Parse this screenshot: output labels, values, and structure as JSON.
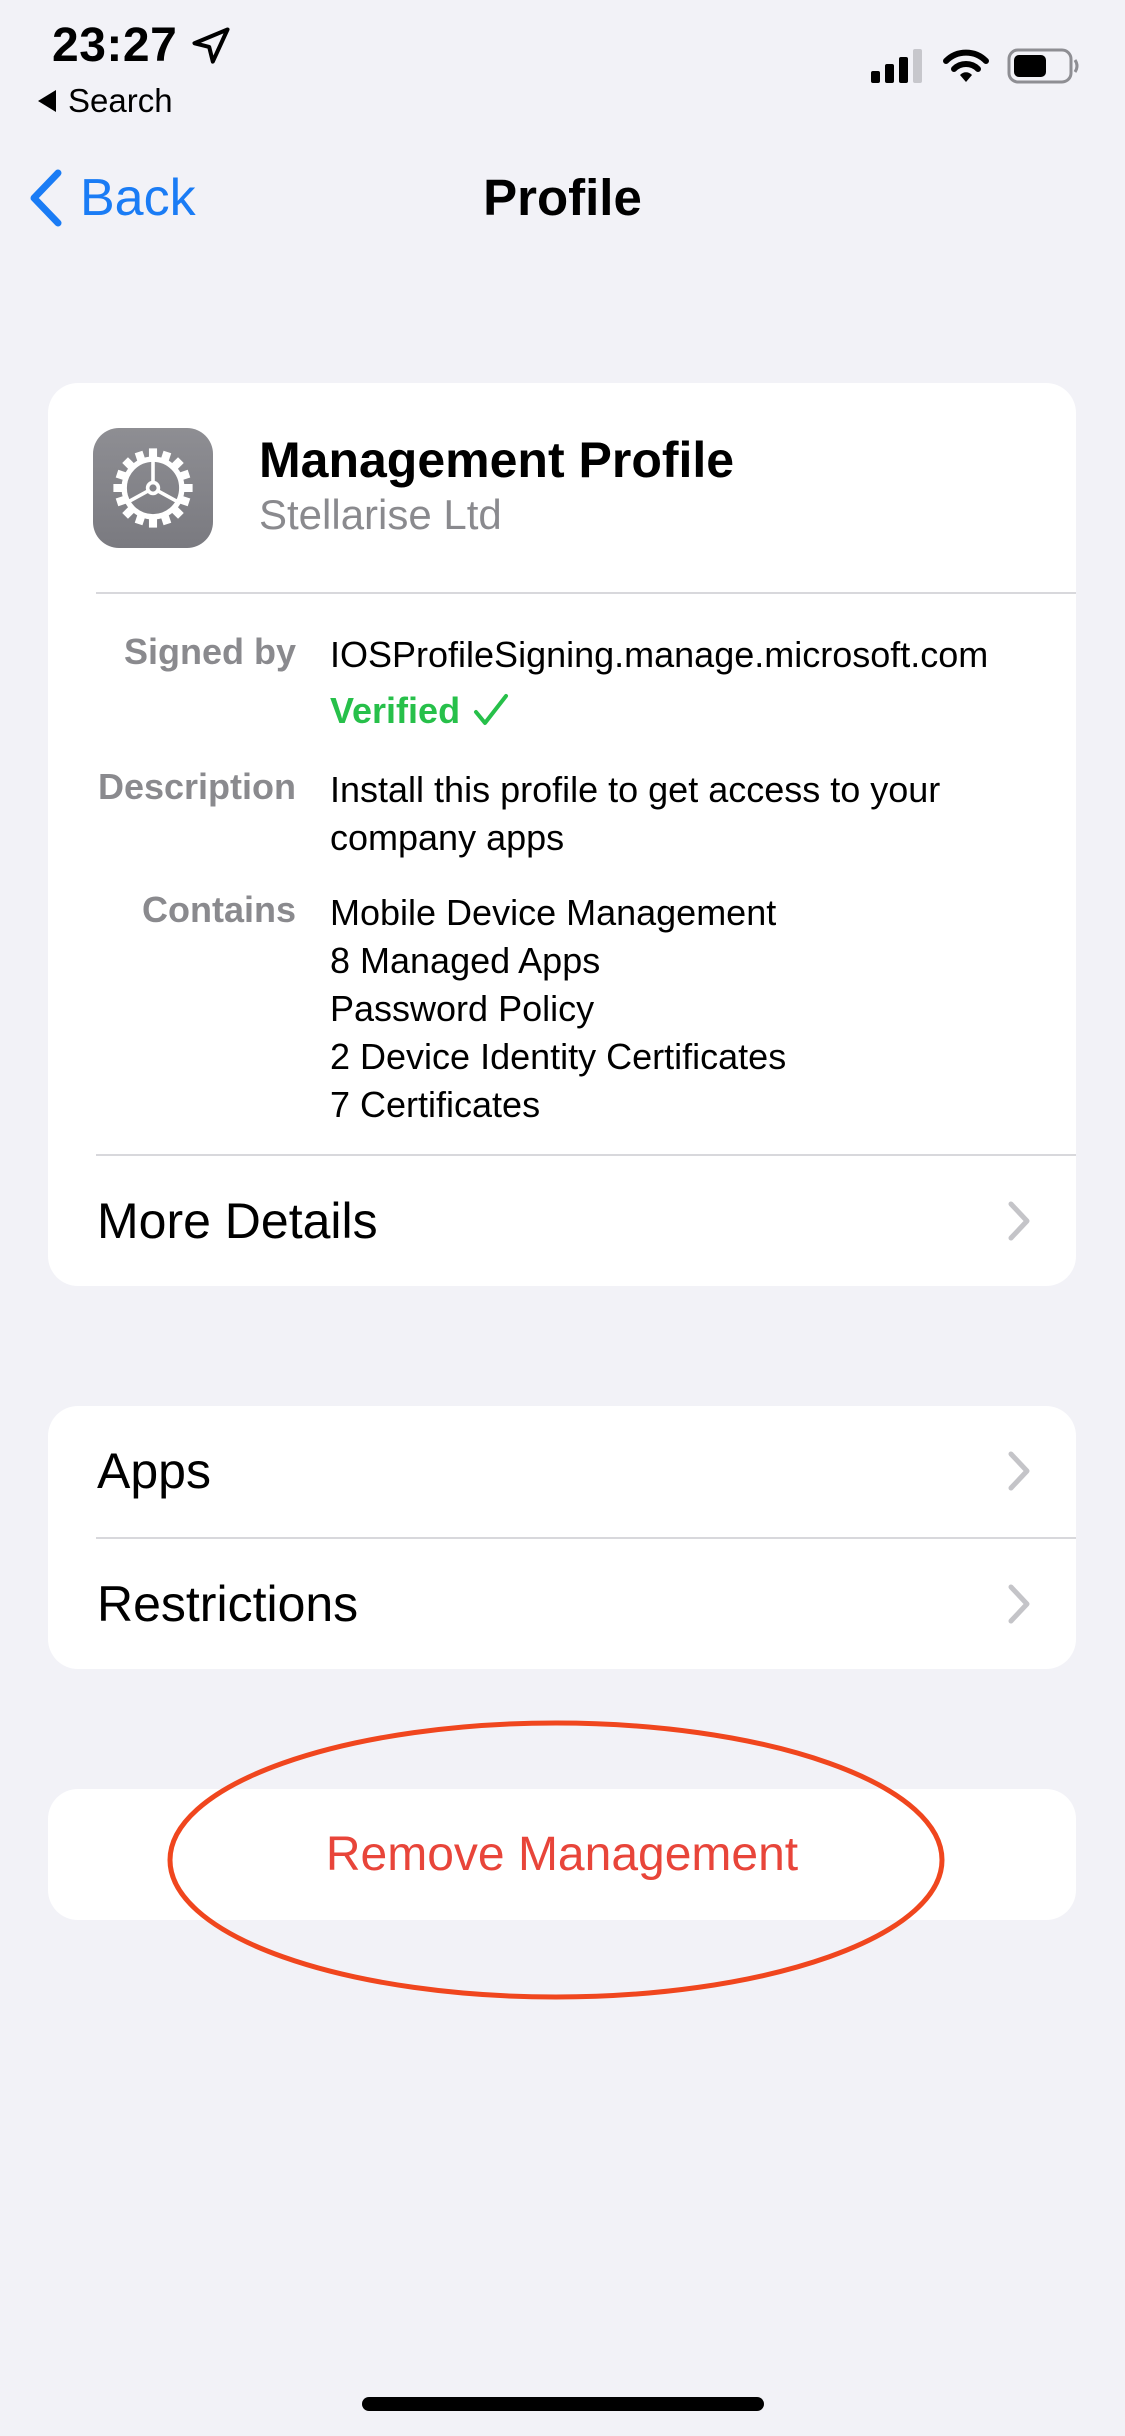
{
  "status_bar": {
    "time": "23:27",
    "back_app": "Search"
  },
  "nav": {
    "back_label": "Back",
    "title": "Profile"
  },
  "profile": {
    "name": "Management Profile",
    "organization": "Stellarise Ltd",
    "signed_by_label": "Signed by",
    "signed_by_value": "IOSProfileSigning.manage.microsoft.com",
    "verified_label": "Verified",
    "description_label": "Description",
    "description_lines": [
      "Install this profile to get access to your",
      "company apps"
    ],
    "contains_label": "Contains",
    "contains_items": [
      "Mobile Device Management",
      "8 Managed Apps",
      "Password Policy",
      "2 Device Identity Certificates",
      "7 Certificates"
    ],
    "more_details_label": "More Details"
  },
  "links": {
    "apps_label": "Apps",
    "restrictions_label": "Restrictions"
  },
  "actions": {
    "remove_label": "Remove Management"
  },
  "colors": {
    "accent": "#1a7cf5",
    "verified": "#27c04a",
    "destructive": "#e8453a",
    "annotation": "#f0461e",
    "background": "#f2f2f7"
  },
  "icons": {
    "location": "location-arrow-icon",
    "back_triangle": "back-triangle-icon",
    "signal": "cellular-signal-icon",
    "wifi": "wifi-icon",
    "battery": "battery-icon",
    "back_chevron": "chevron-left-icon",
    "settings": "gear-icon",
    "verified": "checkmark-icon",
    "disclosure": "chevron-right-icon"
  }
}
